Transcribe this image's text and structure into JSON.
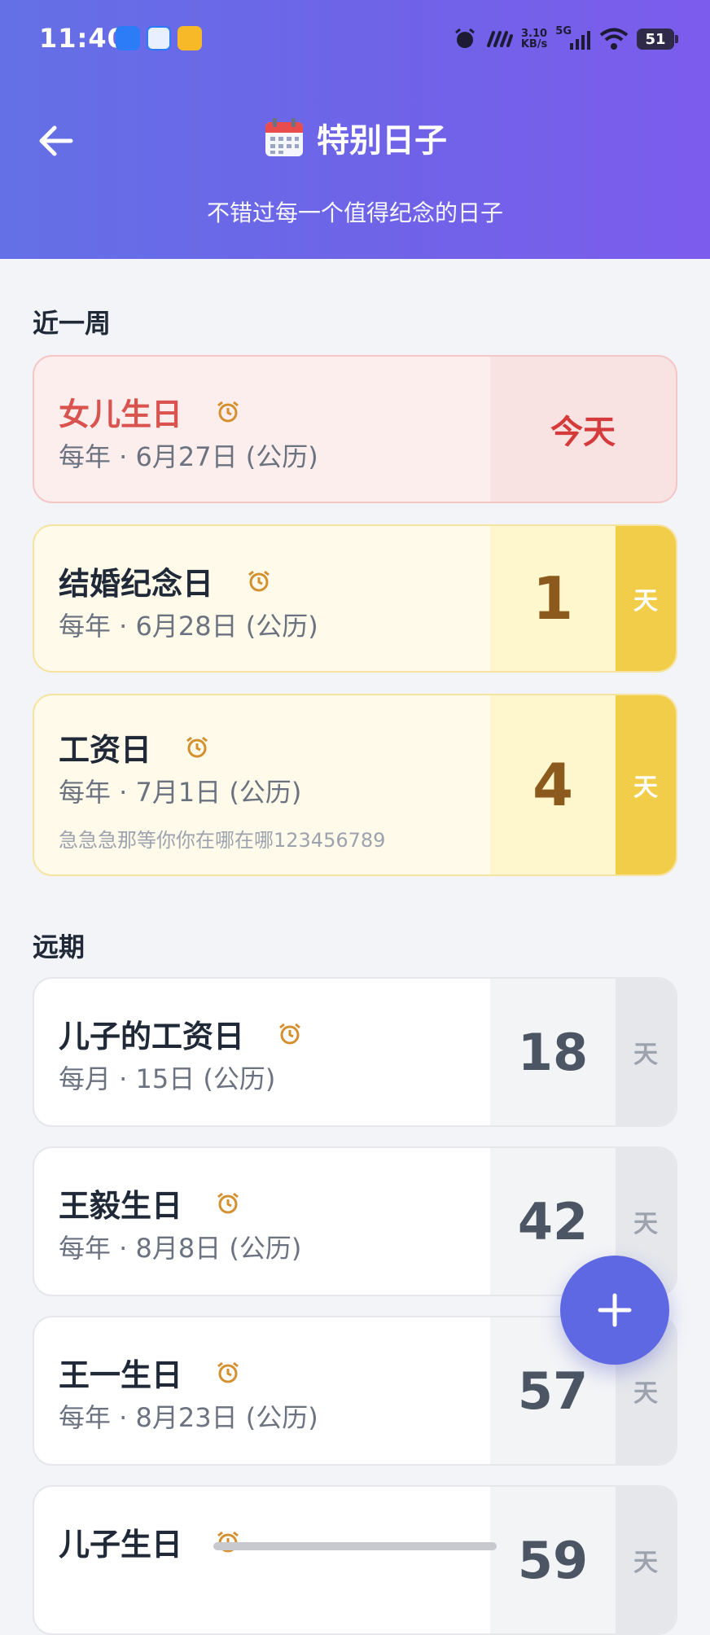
{
  "status_bar": {
    "time": "11:40",
    "speed_top": "3.10",
    "speed_bottom": "KB/s",
    "network": "5G",
    "battery": "51"
  },
  "header": {
    "title": "特别日子",
    "subtitle": "不错过每一个值得纪念的日子"
  },
  "sections": {
    "week_title": "近一周",
    "far_title": "远期"
  },
  "week_items": [
    {
      "name": "女儿生日",
      "date": "每年 · 6月27日 (公历)",
      "count": "今天",
      "unit": ""
    },
    {
      "name": "结婚纪念日",
      "date": "每年 · 6月28日 (公历)",
      "count": "1",
      "unit": "天"
    },
    {
      "name": "工资日",
      "date": "每年 · 7月1日 (公历)",
      "note": "急急急那等你你在哪在哪123456789",
      "count": "4",
      "unit": "天"
    }
  ],
  "far_items": [
    {
      "name": "儿子的工资日",
      "date": "每月 · 15日 (公历)",
      "count": "18",
      "unit": "天"
    },
    {
      "name": "王毅生日",
      "date": "每年 · 8月8日 (公历)",
      "count": "42",
      "unit": "天"
    },
    {
      "name": "王一生日",
      "date": "每年 · 8月23日 (公历)",
      "count": "57",
      "unit": "天"
    },
    {
      "name": "儿子生日",
      "date": "",
      "count": "59",
      "unit": "天"
    }
  ],
  "colors": {
    "header_start": "#6470e6",
    "header_end": "#7c5cec",
    "today_red": "#d63b3b",
    "soon_yellow": "#f1cd4a",
    "fab": "#5f68e3"
  },
  "icons": {
    "back": "arrow-left-icon",
    "title": "calendar-icon",
    "alarm": "alarm-clock-icon",
    "fab": "plus-icon"
  }
}
